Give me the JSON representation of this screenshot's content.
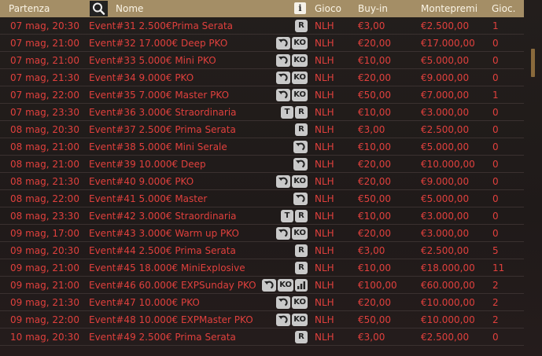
{
  "header": {
    "start": "Partenza",
    "name": "Nome",
    "game": "Gioco",
    "buyin": "Buy-in",
    "prize": "Montepremi",
    "players": "Gioc."
  },
  "rows": [
    {
      "start": "07 mag, 20:30",
      "name": "Event#31 2.500€Prima Serata",
      "badges": [
        "R"
      ],
      "game": "NLH",
      "buyin": "€3,00",
      "prize": "€2.500,00",
      "players": "1"
    },
    {
      "start": "07 mag, 21:00",
      "name": "Event#32 17.000€ Deep PKO",
      "badges": [
        "late-reg-icon",
        "KO"
      ],
      "game": "NLH",
      "buyin": "€20,00",
      "prize": "€17.000,00",
      "players": "0"
    },
    {
      "start": "07 mag, 21:00",
      "name": "Event#33 5.000€ Mini PKO",
      "badges": [
        "late-reg-icon",
        "KO"
      ],
      "game": "NLH",
      "buyin": "€10,00",
      "prize": "€5.000,00",
      "players": "0"
    },
    {
      "start": "07 mag, 21:30",
      "name": "Event#34 9.000€ PKO",
      "badges": [
        "late-reg-icon",
        "KO"
      ],
      "game": "NLH",
      "buyin": "€20,00",
      "prize": "€9.000,00",
      "players": "0"
    },
    {
      "start": "07 mag, 22:00",
      "name": "Event#35 7.000€ Master PKO",
      "badges": [
        "late-reg-icon",
        "KO"
      ],
      "game": "NLH",
      "buyin": "€50,00",
      "prize": "€7.000,00",
      "players": "1"
    },
    {
      "start": "07 mag, 23:30",
      "name": "Event#36 3.000€ Straordinaria",
      "badges": [
        "T",
        "R"
      ],
      "game": "NLH",
      "buyin": "€10,00",
      "prize": "€3.000,00",
      "players": "0"
    },
    {
      "start": "08 mag, 20:30",
      "name": "Event#37 2.500€ Prima Serata",
      "badges": [
        "R"
      ],
      "game": "NLH",
      "buyin": "€3,00",
      "prize": "€2.500,00",
      "players": "0"
    },
    {
      "start": "08 mag, 21:00",
      "name": "Event#38 5.000€ Mini Serale",
      "badges": [
        "late-reg-icon"
      ],
      "game": "NLH",
      "buyin": "€10,00",
      "prize": "€5.000,00",
      "players": "0"
    },
    {
      "start": "08 mag, 21:00",
      "name": "Event#39 10.000€ Deep",
      "badges": [
        "late-reg-icon"
      ],
      "game": "NLH",
      "buyin": "€20,00",
      "prize": "€10.000,00",
      "players": "0"
    },
    {
      "start": "08 mag, 21:30",
      "name": "Event#40 9.000€ PKO",
      "badges": [
        "late-reg-icon",
        "KO"
      ],
      "game": "NLH",
      "buyin": "€20,00",
      "prize": "€9.000,00",
      "players": "0"
    },
    {
      "start": "08 mag, 22:00",
      "name": "Event#41 5.000€ Master",
      "badges": [
        "late-reg-icon"
      ],
      "game": "NLH",
      "buyin": "€50,00",
      "prize": "€5.000,00",
      "players": "0"
    },
    {
      "start": "08 mag, 23:30",
      "name": "Event#42 3.000€ Straordinaria",
      "badges": [
        "T",
        "R"
      ],
      "game": "NLH",
      "buyin": "€10,00",
      "prize": "€3.000,00",
      "players": "0"
    },
    {
      "start": "09 mag, 17:00",
      "name": "Event#43 3.000€ Warm up PKO",
      "badges": [
        "late-reg-icon",
        "KO"
      ],
      "game": "NLH",
      "buyin": "€20,00",
      "prize": "€3.000,00",
      "players": "0"
    },
    {
      "start": "09 mag, 20:30",
      "name": "Event#44 2.500€ Prima Serata",
      "badges": [
        "R"
      ],
      "game": "NLH",
      "buyin": "€3,00",
      "prize": "€2.500,00",
      "players": "5"
    },
    {
      "start": "09 mag, 21:00",
      "name": "Event#45 18.000€ MiniExplosive",
      "badges": [
        "R"
      ],
      "game": "NLH",
      "buyin": "€10,00",
      "prize": "€18.000,00",
      "players": "11"
    },
    {
      "start": "09 mag, 21:00",
      "name": "Event#46 60.000€ EXPSunday PKO",
      "badges": [
        "late-reg-icon",
        "KO",
        "bar-chart-icon"
      ],
      "game": "NLH",
      "buyin": "€100,00",
      "prize": "€60.000,00",
      "players": "2"
    },
    {
      "start": "09 mag, 21:30",
      "name": "Event#47 10.000€ PKO",
      "badges": [
        "late-reg-icon",
        "KO"
      ],
      "game": "NLH",
      "buyin": "€20,00",
      "prize": "€10.000,00",
      "players": "2"
    },
    {
      "start": "09 mag, 22:00",
      "name": "Event#48 10.000€ EXPMaster PKO",
      "badges": [
        "late-reg-icon",
        "KO"
      ],
      "game": "NLH",
      "buyin": "€50,00",
      "prize": "€10.000,00",
      "players": "2"
    },
    {
      "start": "10 mag, 20:30",
      "name": "Event#49 2.500€ Prima Serata",
      "badges": [
        "R"
      ],
      "game": "NLH",
      "buyin": "€3,00",
      "prize": "€2.500,00",
      "players": "0"
    }
  ],
  "colors": {
    "header_bg": "#a48e66",
    "row_text": "#e0403d",
    "background": "#221c1a",
    "badge_bg": "#c9c9c9",
    "scrollbar": "#8a6a3c"
  },
  "icons": {
    "search": "search-icon",
    "info": "info-icon"
  },
  "info_label": "i"
}
